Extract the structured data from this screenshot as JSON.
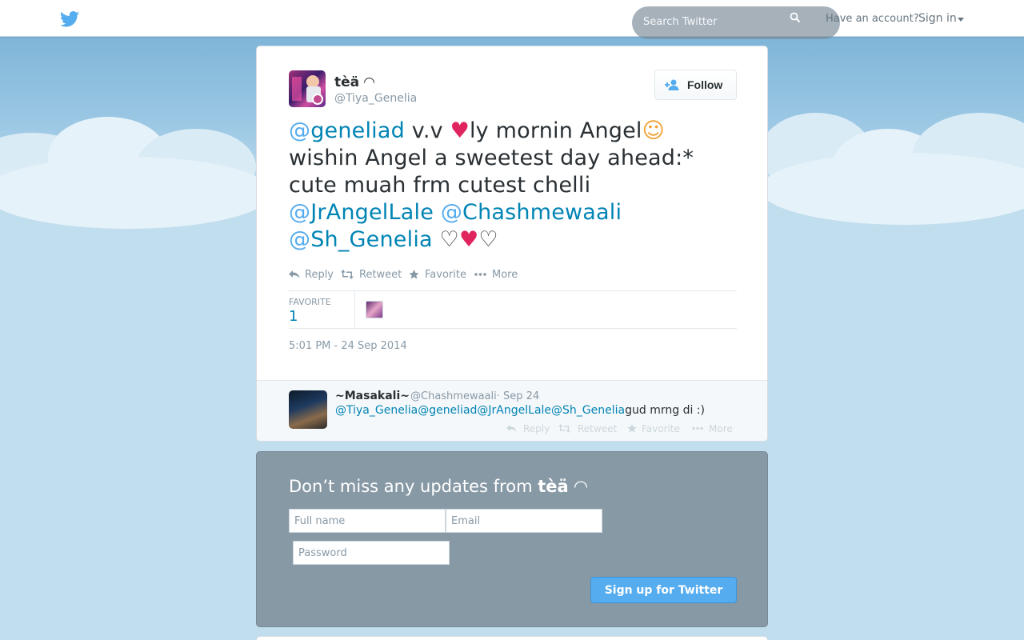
{
  "header": {
    "search_placeholder": "Search Twitter",
    "have_account": "Have an account?",
    "sign_in": "Sign in"
  },
  "tweet": {
    "fullname": "tèä ◠",
    "username": "@Tiya_Genelia",
    "follow_label": "Follow",
    "text": {
      "mention1": "geneliad",
      "part1": " v.v ",
      "heart1": "♥",
      "part2": "ly mornin Angel",
      "emoji": "☺",
      "part3": " wishin Angel a sweetest day ahead:* cute muah frm cutest chelli ",
      "mention2": "JrAngelLale",
      "mention3": "Chashmewaali",
      "mention4": "Sh_Genelia",
      "tail1": " ♡",
      "heart2": "♥",
      "tail2": "♡"
    },
    "actions": {
      "reply": "Reply",
      "retweet": "Retweet",
      "favorite": "Favorite",
      "more": "More"
    },
    "favorites_label": "FAVORITE",
    "favorites_count": "1",
    "timestamp": "5:01 PM - 24 Sep 2014"
  },
  "reply": {
    "fullname": "~Masakali~",
    "username_date": "@Chashmewaali· Sep 24",
    "mentions": [
      "@Tiya_Genelia",
      "@geneliad",
      "@JrAngelLale",
      "@Sh_Genelia"
    ],
    "text": "gud mrng di :)",
    "actions": {
      "reply": "Reply",
      "retweet": "Retweet",
      "favorite": "Favorite",
      "more": "More"
    }
  },
  "signup": {
    "title_prefix": "Don’t miss any updates from ",
    "title_name": "tèä ◠",
    "fullname_placeholder": "Full name",
    "email_placeholder": "Email",
    "password_placeholder": "Password",
    "button": "Sign up for Twitter"
  },
  "colors": {
    "link": "#0084b4",
    "accent": "#55acee",
    "heart": "#e0245e",
    "signup_bg": "#8899a6"
  }
}
